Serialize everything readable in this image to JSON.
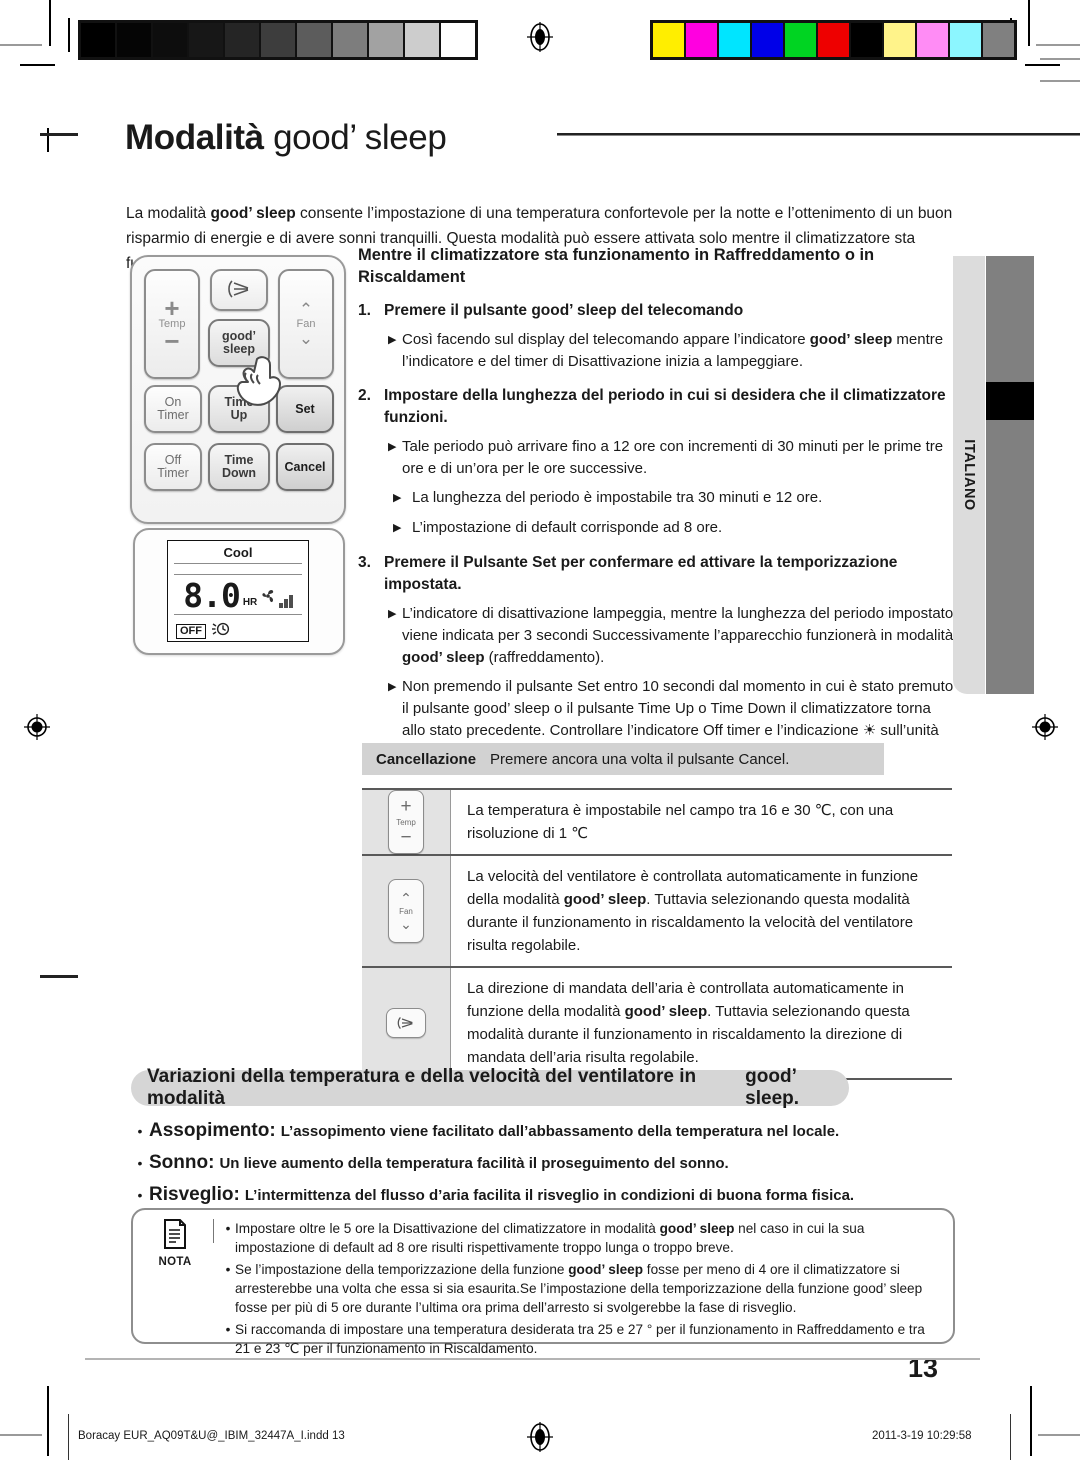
{
  "header": {
    "title_main": "Modalità ",
    "title_brand": "good’ sleep",
    "language_tab": "ITALIANO"
  },
  "intro": {
    "p1_a": "La modalità ",
    "p1_brand": "good’ sleep",
    "p1_b": " consente l’impostazione di una temperatura confortevole per la notte e l’ottenimento di un buon risparmio di energie e di avere sonni tranquilli. Questa modalità può essere attivata solo mentre il climatizzatore sta funzionando."
  },
  "remote": {
    "temp_label": "Temp",
    "temp_plus": "+",
    "temp_minus": "−",
    "fan_label": "Fan",
    "fan_up": "⌃",
    "fan_down": "⌄",
    "swing_icon": "air-direction-icon",
    "goodsleep_line1": "good’",
    "goodsleep_line2": "sleep",
    "on_timer_line1": "On",
    "on_timer_line2": "Timer",
    "time_up_line1": "Time",
    "time_up_line2": "Up",
    "set_label": "Set",
    "off_timer_line1": "Off",
    "off_timer_line2": "Timer",
    "time_down_line1": "Time",
    "time_down_line2": "Down",
    "cancel_label": "Cancel",
    "hand_icon": "pointing-hand-icon"
  },
  "lcd": {
    "mode": "Cool",
    "value": "8.0",
    "unit": "HR",
    "fan_icon": "fan-icon",
    "signal_bars": 3,
    "off_label": "OFF",
    "timer_icon": "off-timer-icon"
  },
  "instructions": {
    "heading": "Mentre il climatizzatore sta funzionamento in Raffreddamento o in Riscaldament",
    "steps": [
      {
        "num": "1.",
        "text_a": "Premere il pulsante ",
        "brand": "good’ sleep",
        "text_b": " del telecomando",
        "bullets": [
          {
            "indent": false,
            "a": "Così facendo sul display del telecomando appare l’indicatore ",
            "brand": "good’ sleep",
            "b": " mentre l’indicatore e del timer di Disattivazione inizia a lampeggiare."
          }
        ]
      },
      {
        "num": "2.",
        "text_a": "Impostare della lunghezza del periodo in cui si desidera che il climatizzatore funzioni.",
        "brand": "",
        "text_b": "",
        "bullets": [
          {
            "indent": false,
            "a": "Tale periodo può arrivare fino a 12 ore con incrementi di 30 minuti per le prime tre ore e di un’ora per le ore successive.",
            "brand": "",
            "b": ""
          },
          {
            "indent": true,
            "a": "La lunghezza del periodo è impostabile tra 30 minuti e 12 ore.",
            "brand": "",
            "b": ""
          },
          {
            "indent": true,
            "a": "L’impostazione di default corrisponde ad 8 ore.",
            "brand": "",
            "b": ""
          }
        ]
      },
      {
        "num": "3.",
        "text_a": "Premere il Pulsante Set per confermare ed attivare  la temporizzazione impostata.",
        "brand": "",
        "text_b": "",
        "bullets": [
          {
            "indent": false,
            "a": "L’indicatore di disattivazione lampeggia, mentre la lunghezza del periodo impostato viene indicata per 3 secondi Successivamente l’apparecchio funzionerà in modalità ",
            "brand": "good’ sleep",
            "b": " (raffreddamento)."
          },
          {
            "indent": false,
            "a": "Non premendo il pulsante Set entro 10 secondi dal momento in cui è stato premuto il pulsante good’ sleep o il pulsante Time Up o Time Down il climatizzatore torna allo stato precedente.  Controllare l’indicatore Off timer e l’indicazione ☀ sull’unità interna.",
            "brand": "",
            "b": ""
          }
        ]
      }
    ]
  },
  "cancellation": {
    "key": "Cancellazione",
    "value": "Premere ancora una volta il pulsante Cancel."
  },
  "feature_table": {
    "rows": [
      {
        "icon": "temp-button-icon",
        "icon_top": "+",
        "icon_label": "Temp",
        "icon_bottom": "−",
        "text_a": "La temperatura è impostabile nel campo tra 16 e 30 ℃, con una risoluzione di 1 ℃",
        "brand": "",
        "text_b": ""
      },
      {
        "icon": "fan-button-icon",
        "icon_top": "⌃",
        "icon_label": "Fan",
        "icon_bottom": "⌄",
        "text_a": "La velocità del ventilatore è controllata automaticamente in funzione della modalità ",
        "brand": "good’ sleep",
        "text_b": ". Tuttavia selezionando questa modalità durante il funzionamento in riscaldamento la velocità del ventilatore risulta regolabile."
      },
      {
        "icon": "air-direction-button-icon",
        "icon_top": "",
        "icon_label": "",
        "icon_bottom": "",
        "text_a": "La direzione di mandata dell’aria è controllata automaticamente in funzione della modalità ",
        "brand": "good’ sleep",
        "text_b": ". Tuttavia selezionando questa modalità durante il funzionamento in riscaldamento la direzione di mandata dell’aria risulta regolabile."
      }
    ]
  },
  "variations": {
    "banner_a": "Variazioni della temperatura e della velocità del ventilatore in modalità ",
    "banner_brand": "good’ sleep.",
    "items": [
      {
        "key": "Assopimento:",
        "value": "L’assopimento viene facilitato dall’abbassamento della temperatura nel locale."
      },
      {
        "key": "Sonno:",
        "value": "Un lieve aumento della temperatura facilità il proseguimento del sonno."
      },
      {
        "key": "Risveglio:",
        "value": "L’intermittenza del flusso d’aria facilita il risveglio in condizioni di buona forma fisica."
      }
    ]
  },
  "nota": {
    "icon": "note-document-icon",
    "caption": "NOTA",
    "items": [
      {
        "a": "Impostare oltre le 5 ore la Disattivazione del climatizzatore in modalità ",
        "brand": "good’ sleep",
        "b": " nel caso in cui la sua impostazione di default ad 8 ore risulti rispettivamente troppo lunga o troppo breve."
      },
      {
        "a": "Se l’impostazione della temporizzazione della funzione ",
        "brand": "good’ sleep",
        "b": " fosse per meno di 4 ore il climatizzatore si arresterebbe una volta che essa si sia esaurita.Se l’impostazione della temporizzazione della funzione good’ sleep fosse per più di 5 ore durante l’ultima ora prima dell’arresto si svolgerebbe la fase di risveglio."
      },
      {
        "a": "Si raccomanda di impostare una temperatura desiderata tra 25 e 27 ° per il funzionamento in Raffreddamento e tra 21 e 23 ℃ per il funzionamento in Riscaldamento.",
        "brand": "",
        "b": ""
      }
    ]
  },
  "footer": {
    "page_number": "13",
    "file_name": "Boracay EUR_AQ09T&U@_IBIM_32447A_I.indd   13",
    "timestamp": "2011-3-19   10:29:58"
  },
  "calibration": {
    "grayscale": [
      "#000000",
      "#050505",
      "#0d0d0d",
      "#171717",
      "#252525",
      "#3d3d3d",
      "#5c5c5c",
      "#7d7d7d",
      "#a2a2a2",
      "#cdcdcd",
      "#ffffff"
    ],
    "colors": [
      "#ffee00",
      "#ff00e0",
      "#00e5ff",
      "#0000e8",
      "#00d422",
      "#ee0000",
      "#000000",
      "#fff38a",
      "#ff8cf5",
      "#8cf6ff",
      "#808080"
    ],
    "registration_icon": "registration-target-icon"
  }
}
